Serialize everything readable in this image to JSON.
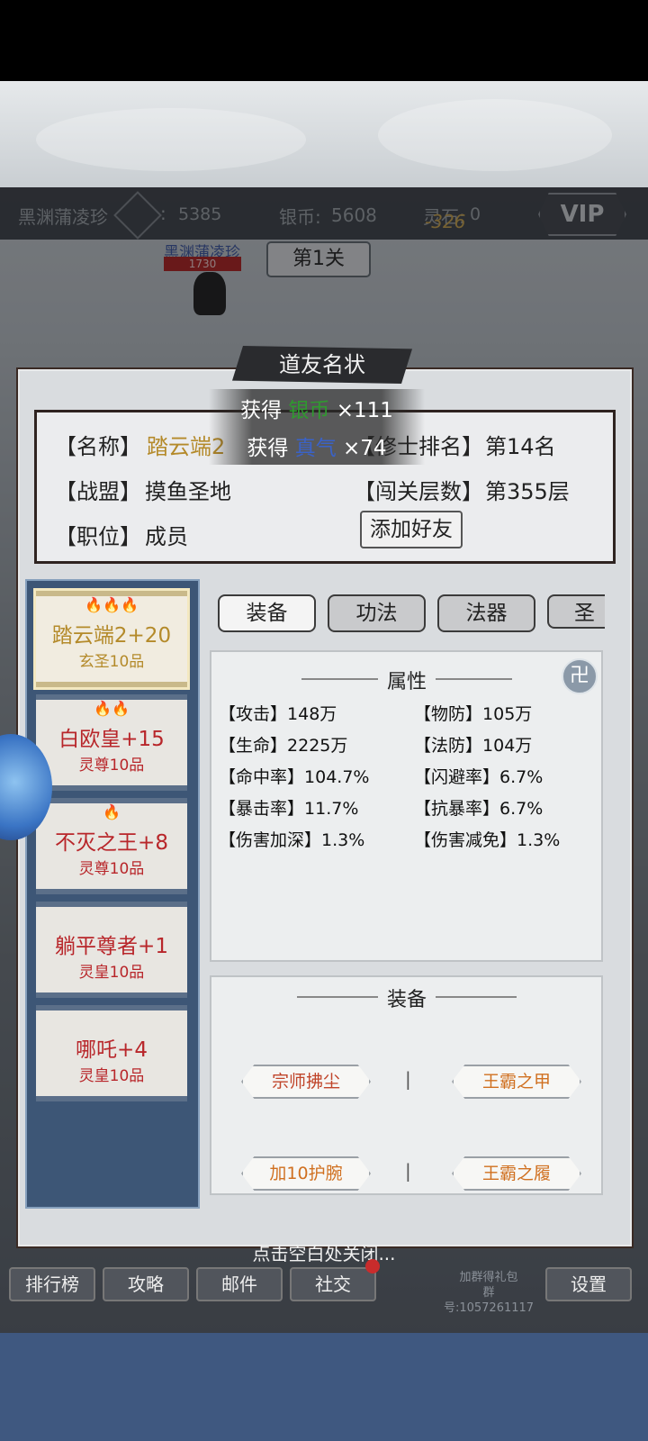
{
  "top_bar": {
    "player_name": "黑渊蒲凌珍",
    "power_colon": ":",
    "power_value": "5385",
    "silver_label": "银币:",
    "silver_value": "5608",
    "spirit_label": "灵石:",
    "spirit_value": "0",
    "float_number": "-326",
    "vip_label": "VIP"
  },
  "scene": {
    "character_name": "黑渊蒲凌珍",
    "character_hp": "1730",
    "stage_label": "第1关"
  },
  "dialog": {
    "title": "道友名状",
    "info": {
      "name_label": "【名称】",
      "name_value": "踏云端2",
      "rank_label": "【修士排名】",
      "rank_value": "第14名",
      "alliance_label": "【战盟】",
      "alliance_value": "摸鱼圣地",
      "floor_label": "【闯关层数】",
      "floor_value": "第355层",
      "position_label": "【职位】",
      "position_value": "成员",
      "add_friend_button": "添加好友"
    },
    "toast": [
      {
        "prefix": "获得",
        "item": "银币",
        "amount": "×111",
        "color": "#2f9a2f"
      },
      {
        "prefix": "获得",
        "item": "真气",
        "amount": "×74",
        "color": "#3a62c8"
      }
    ],
    "characters": [
      {
        "flames": "🔥🔥🔥",
        "name": "踏云端2+20",
        "grade": "玄圣10品"
      },
      {
        "flames": "🔥🔥",
        "name": "白欧皇+15",
        "grade": "灵尊10品"
      },
      {
        "flames": "🔥",
        "name": "不灭之王+8",
        "grade": "灵尊10品"
      },
      {
        "flames": "",
        "name": "躺平尊者+1",
        "grade": "灵皇10品"
      },
      {
        "flames": "",
        "name": "哪吒+4",
        "grade": "灵皇10品"
      }
    ],
    "tabs": [
      "装备",
      "功法",
      "法器",
      "圣E"
    ],
    "attributes": {
      "title": "属性",
      "rune_icon": "卍",
      "items": [
        {
          "label": "【攻击】",
          "value": "148万"
        },
        {
          "label": "【物防】",
          "value": "105万"
        },
        {
          "label": "【生命】",
          "value": "2225万"
        },
        {
          "label": "【法防】",
          "value": "104万"
        },
        {
          "label": "【命中率】",
          "value": "104.7%"
        },
        {
          "label": "【闪避率】",
          "value": "6.7%"
        },
        {
          "label": "【暴击率】",
          "value": "11.7%"
        },
        {
          "label": "【抗暴率】",
          "value": "6.7%"
        },
        {
          "label": "【伤害加深】",
          "value": "1.3%"
        },
        {
          "label": "【伤害减免】",
          "value": "1.3%"
        }
      ]
    },
    "equipment": {
      "title": "装备",
      "items": [
        "宗师拂尘",
        "王霸之甲",
        "加10护腕",
        "王霸之履"
      ],
      "separator": "|"
    },
    "close_hint": "点击空白处关闭..."
  },
  "bottom_nav": {
    "items": [
      "排行榜",
      "攻略",
      "邮件",
      "社交"
    ],
    "group_text_1": "加群得礼包",
    "group_text_2": "群号:1057261117",
    "settings": "设置"
  }
}
